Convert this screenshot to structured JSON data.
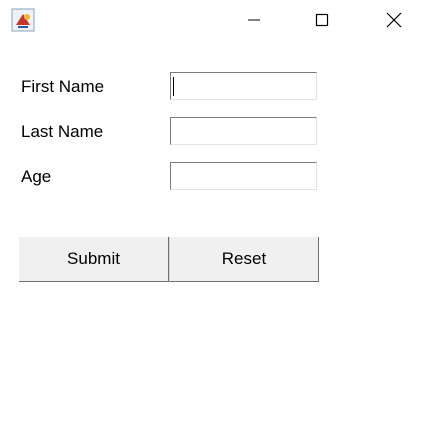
{
  "window": {
    "app_icon": "java-app-icon",
    "controls": {
      "minimize": "minimize-icon",
      "maximize": "maximize-icon",
      "close": "close-icon"
    }
  },
  "form": {
    "first_name_label": "First Name",
    "last_name_label": "Last Name",
    "age_label": "Age",
    "first_name_value": "",
    "last_name_value": "",
    "age_value": ""
  },
  "buttons": {
    "submit": "Submit",
    "reset": "Reset"
  }
}
